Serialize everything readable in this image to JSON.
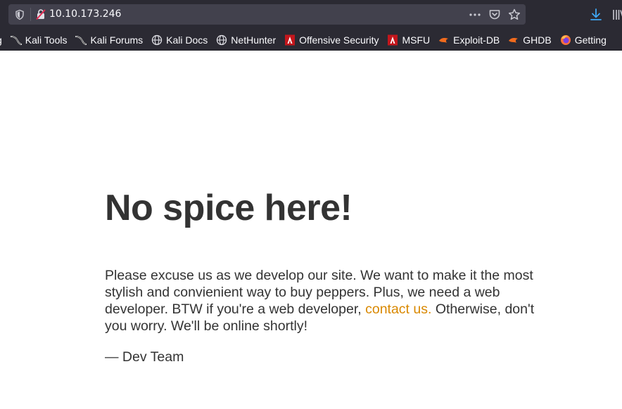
{
  "browser": {
    "url": "10.10.173.246",
    "bookmarks": [
      {
        "label": "g",
        "icon": "page-icon"
      },
      {
        "label": "Kali Tools",
        "icon": "kali-dragon-icon"
      },
      {
        "label": "Kali Forums",
        "icon": "kali-dragon-icon"
      },
      {
        "label": "Kali Docs",
        "icon": "globe-icon"
      },
      {
        "label": "NetHunter",
        "icon": "globe-icon"
      },
      {
        "label": "Offensive Security",
        "icon": "offsec-icon"
      },
      {
        "label": "MSFU",
        "icon": "offsec-icon"
      },
      {
        "label": "Exploit-DB",
        "icon": "exploitdb-icon"
      },
      {
        "label": "GHDB",
        "icon": "exploitdb-icon"
      },
      {
        "label": "Getting",
        "icon": "firefox-icon"
      }
    ]
  },
  "page": {
    "headline": "No spice here!",
    "message_part1": "Please excuse us as we develop our site. We want to make it the most stylish and convienient way to buy peppers. Plus, we need a web developer. BTW if you're a web developer, ",
    "contact_link": "contact us.",
    "message_part2": " Otherwise, don't you worry. We'll be online shortly!",
    "signature": "— Dev Team"
  },
  "colors": {
    "toolbar_bg": "#2b2a33",
    "urlbar_bg": "#42414d",
    "text": "#333333",
    "link": "#d98800",
    "download_accent": "#3fa7f5"
  }
}
